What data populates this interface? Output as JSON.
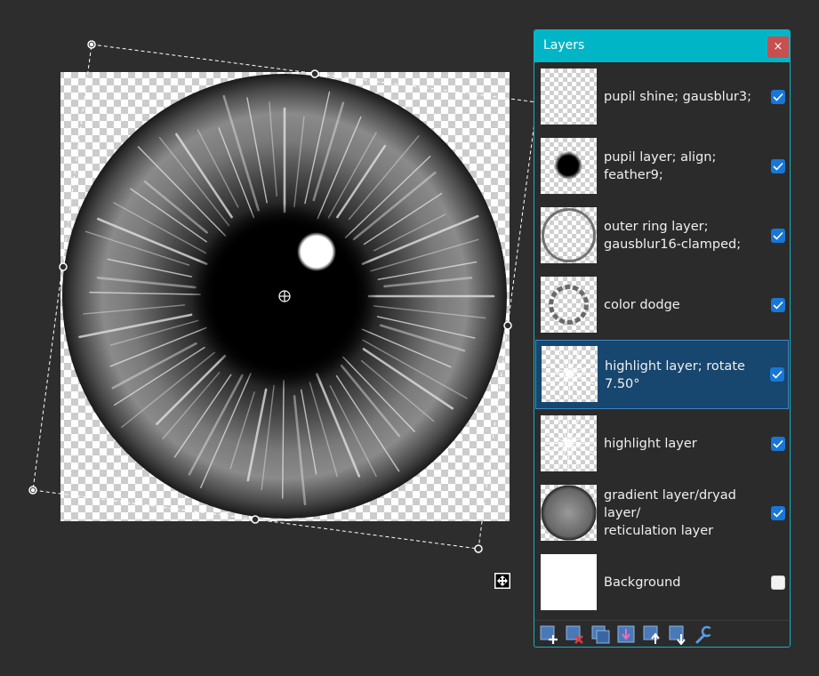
{
  "panel": {
    "title": "Layers",
    "close_label": "×",
    "layers": [
      {
        "name": "pupil shine; gausblur3;",
        "visible": true
      },
      {
        "name": "pupil layer; align; feather9;",
        "visible": true
      },
      {
        "name": "outer ring layer;\ngausblur16-clamped;",
        "visible": true
      },
      {
        "name": "color dodge",
        "visible": true
      },
      {
        "name": "highlight layer; rotate 7.50°",
        "visible": true,
        "selected": true
      },
      {
        "name": "highlight layer",
        "visible": true
      },
      {
        "name": "gradient layer/dryad layer/\nreticulation layer",
        "visible": true
      },
      {
        "name": "Background",
        "visible": false
      }
    ]
  },
  "toolbar": [
    "add-layer-icon",
    "delete-layer-icon",
    "duplicate-layer-icon",
    "merge-down-icon",
    "move-up-icon",
    "move-down-icon",
    "properties-icon"
  ],
  "colors": {
    "accent": "#00b6c6",
    "selection": "#17466e",
    "checkbox": "#1877d6",
    "close": "#c84f4f"
  }
}
